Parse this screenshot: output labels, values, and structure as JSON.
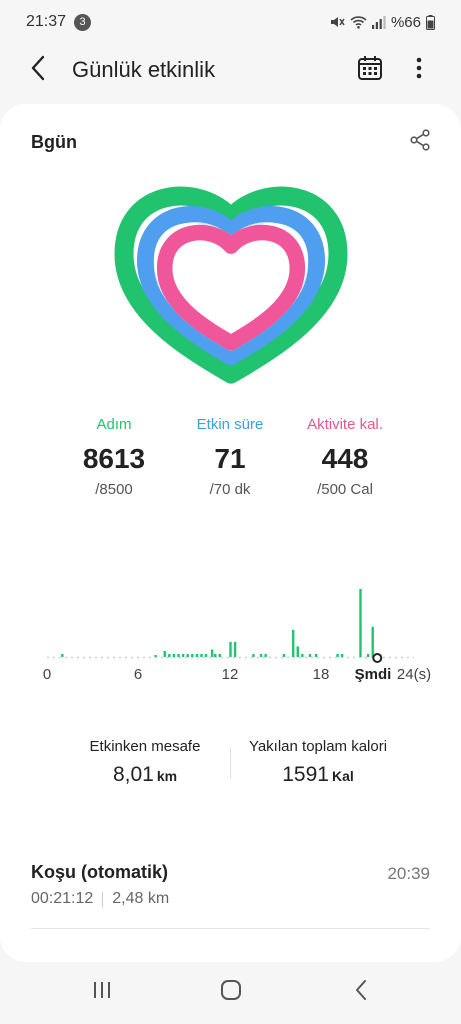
{
  "status_bar": {
    "time": "21:37",
    "notification_count": "3",
    "battery": "%66"
  },
  "header": {
    "title": "Günlük etkinlik",
    "back_icon": "back-arrow-icon",
    "calendar_icon": "calendar-icon",
    "more_icon": "more-vertical-icon"
  },
  "card": {
    "title": "Bgün",
    "share_icon": "share-icon"
  },
  "rings": {
    "steps_color": "#21c36f",
    "active_time_color": "#4f9ef0",
    "calories_color": "#f0579a",
    "steps_progress": 1.0,
    "active_time_progress": 1.0,
    "calories_progress": 0.9
  },
  "stats": [
    {
      "label": "Adım",
      "value": "8613",
      "goal": "/8500",
      "color": "#21c36f"
    },
    {
      "label": "Etkin süre",
      "value": "71",
      "goal": "/70 dk",
      "color": "#3aa3d6"
    },
    {
      "label": "Aktivite kal.",
      "value": "448",
      "goal": "/500 Cal",
      "color": "#e9568f"
    }
  ],
  "chart_data": {
    "type": "bar",
    "xlabel": "",
    "ylabel": "",
    "xlim": [
      0,
      24
    ],
    "x_ticks": [
      "0",
      "6",
      "12",
      "18",
      "Şmdi",
      "24(s)"
    ],
    "x_tick_values": [
      0,
      6,
      12,
      18,
      21.5,
      24
    ],
    "current_hour": 21.6,
    "bar_color": "#21c36f",
    "x": [
      1.0,
      7.1,
      7.7,
      8.0,
      8.3,
      8.6,
      8.9,
      9.2,
      9.5,
      9.8,
      10.1,
      10.4,
      10.8,
      11.0,
      11.3,
      12.0,
      12.3,
      13.5,
      14.0,
      14.3,
      15.5,
      16.1,
      16.4,
      16.7,
      17.2,
      17.6,
      19.0,
      19.3,
      20.5,
      21.0,
      21.3
    ],
    "values": [
      2,
      1,
      4,
      2,
      2,
      2,
      2,
      2,
      2,
      2,
      2,
      2,
      5,
      2,
      2,
      10,
      10,
      2,
      2,
      2,
      2,
      18,
      7,
      2,
      2,
      2,
      2,
      2,
      45,
      2,
      20
    ]
  },
  "summary": {
    "distance_label": "Etkinken mesafe",
    "distance_value": "8,01",
    "distance_unit": "km",
    "calories_label": "Yakılan toplam kalori",
    "calories_value": "1591",
    "calories_unit": "Kal"
  },
  "workout": {
    "name": "Koşu (otomatik)",
    "time": "20:39",
    "duration": "00:21:12",
    "distance": "2,48 km"
  },
  "nav": {
    "recents_icon": "recents-icon",
    "home_icon": "home-icon",
    "back_icon": "nav-back-icon"
  }
}
